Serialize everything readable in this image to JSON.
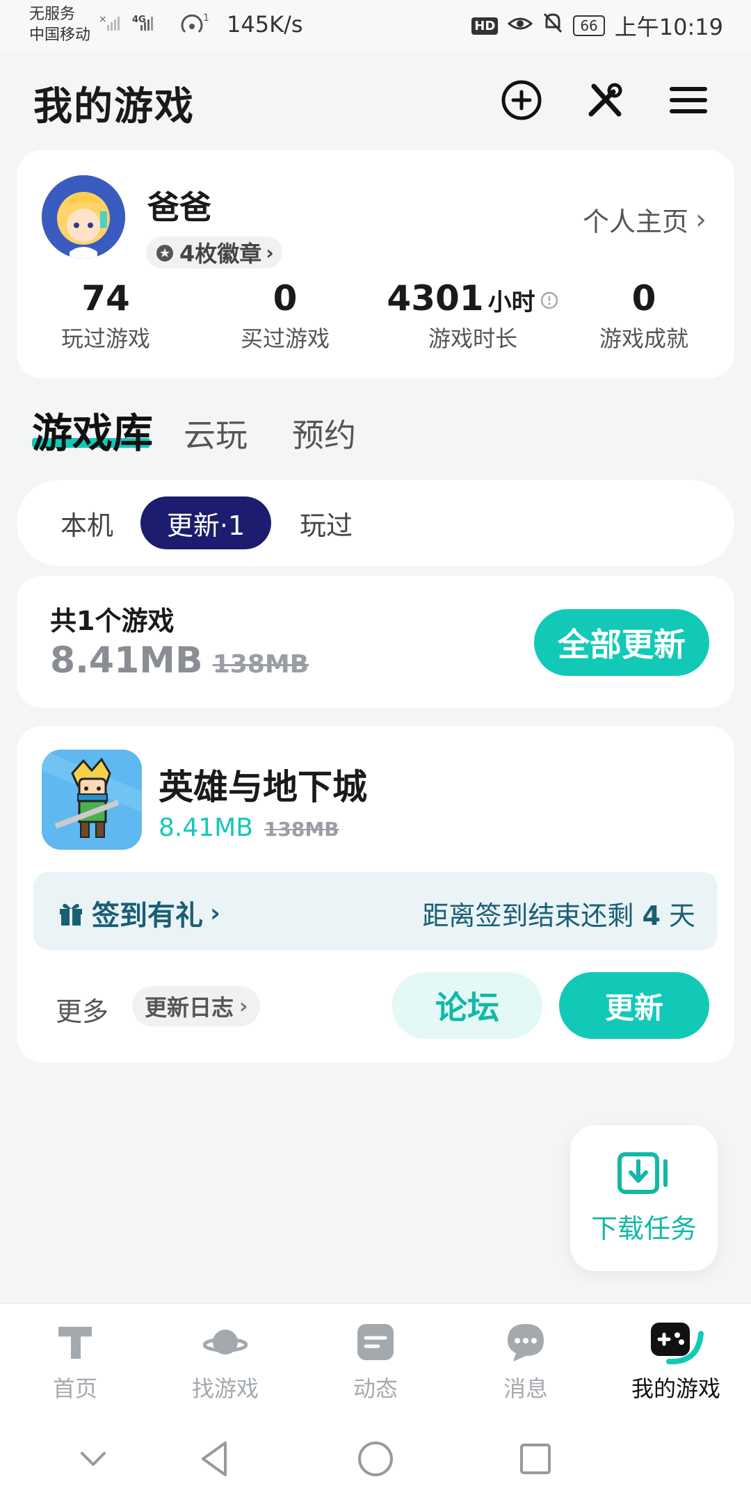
{
  "status_bar": {
    "carrier_line1": "无服务",
    "carrier_line2": "中国移动",
    "signal": "4G",
    "wifi_count": "1",
    "speed": "145K/s",
    "hd": "HD",
    "battery": "66",
    "time": "上午10:19"
  },
  "header": {
    "title": "我的游戏"
  },
  "profile": {
    "username": "爸爸",
    "badges": "4枚徽章",
    "homepage_link": "个人主页",
    "stats": [
      {
        "value": "74",
        "unit": "",
        "label": "玩过游戏"
      },
      {
        "value": "0",
        "unit": "",
        "label": "买过游戏"
      },
      {
        "value": "4301",
        "unit": "小时",
        "label": "游戏时长"
      },
      {
        "value": "0",
        "unit": "",
        "label": "游戏成就"
      }
    ]
  },
  "section_tabs": [
    "游戏库",
    "云玩",
    "预约"
  ],
  "filters": [
    "本机",
    "更新·1",
    "玩过"
  ],
  "summary": {
    "title": "共1个游戏",
    "size": "8.41MB",
    "original_size": "138MB",
    "update_all": "全部更新"
  },
  "game": {
    "name": "英雄与地下城",
    "size": "8.41MB",
    "original_size": "138MB",
    "checkin_label": "签到有礼",
    "checkin_remaining_prefix": "距离签到结束还剩",
    "checkin_remaining_days": "4",
    "checkin_remaining_suffix": "天",
    "more": "更多",
    "changelog": "更新日志",
    "forum": "论坛",
    "update": "更新"
  },
  "download_fab": {
    "label": "下载任务"
  },
  "bottom_nav": [
    {
      "label": "首页",
      "icon": "home-icon"
    },
    {
      "label": "找游戏",
      "icon": "planet-icon"
    },
    {
      "label": "动态",
      "icon": "feed-icon"
    },
    {
      "label": "消息",
      "icon": "chat-icon"
    },
    {
      "label": "我的游戏",
      "icon": "gamepad-icon"
    }
  ],
  "colors": {
    "accent": "#12c9b8",
    "active_chip": "#1c1d6e",
    "background": "#f3f5f7"
  }
}
